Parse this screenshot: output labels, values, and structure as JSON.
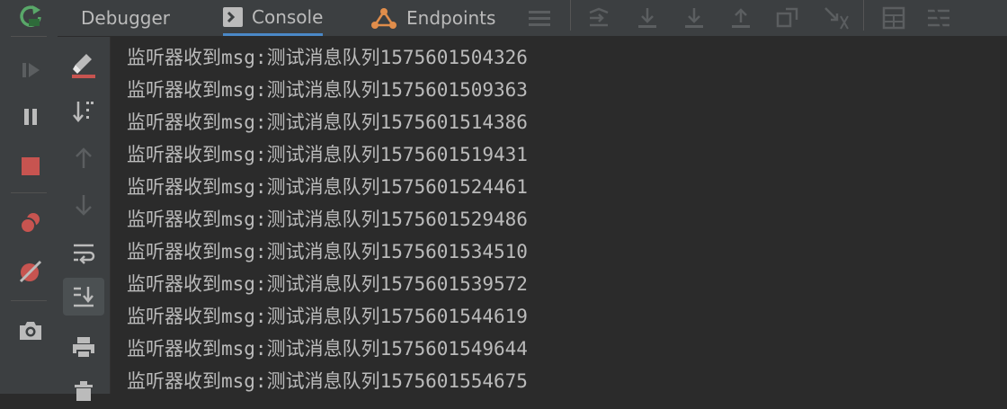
{
  "tabs": {
    "debugger": "Debugger",
    "console": "Console",
    "endpoints": "Endpoints"
  },
  "console": {
    "lines": [
      "监听器收到msg:测试消息队列1575601504326",
      "监听器收到msg:测试消息队列1575601509363",
      "监听器收到msg:测试消息队列1575601514386",
      "监听器收到msg:测试消息队列1575601519431",
      "监听器收到msg:测试消息队列1575601524461",
      "监听器收到msg:测试消息队列1575601529486",
      "监听器收到msg:测试消息队列1575601534510",
      "监听器收到msg:测试消息队列1575601539572",
      "监听器收到msg:测试消息队列1575601544619",
      "监听器收到msg:测试消息队列1575601549644",
      "监听器收到msg:测试消息队列1575601554675"
    ]
  },
  "colors": {
    "accent": "#4a88c7",
    "rerun_green": "#59a869",
    "stop_red": "#c75450",
    "text": "#bbbbbb"
  },
  "icons": {
    "left_strip": [
      "rerun-icon",
      "resume-icon",
      "pause-icon",
      "stop-icon",
      "view-breakpoints-icon",
      "mute-breakpoints-icon",
      "camera-icon"
    ],
    "console_tools": [
      "clear-icon",
      "sort-icon",
      "up-arrow-icon",
      "down-arrow-icon",
      "soft-wrap-icon",
      "scroll-to-end-icon",
      "print-icon",
      "trash-icon"
    ]
  }
}
